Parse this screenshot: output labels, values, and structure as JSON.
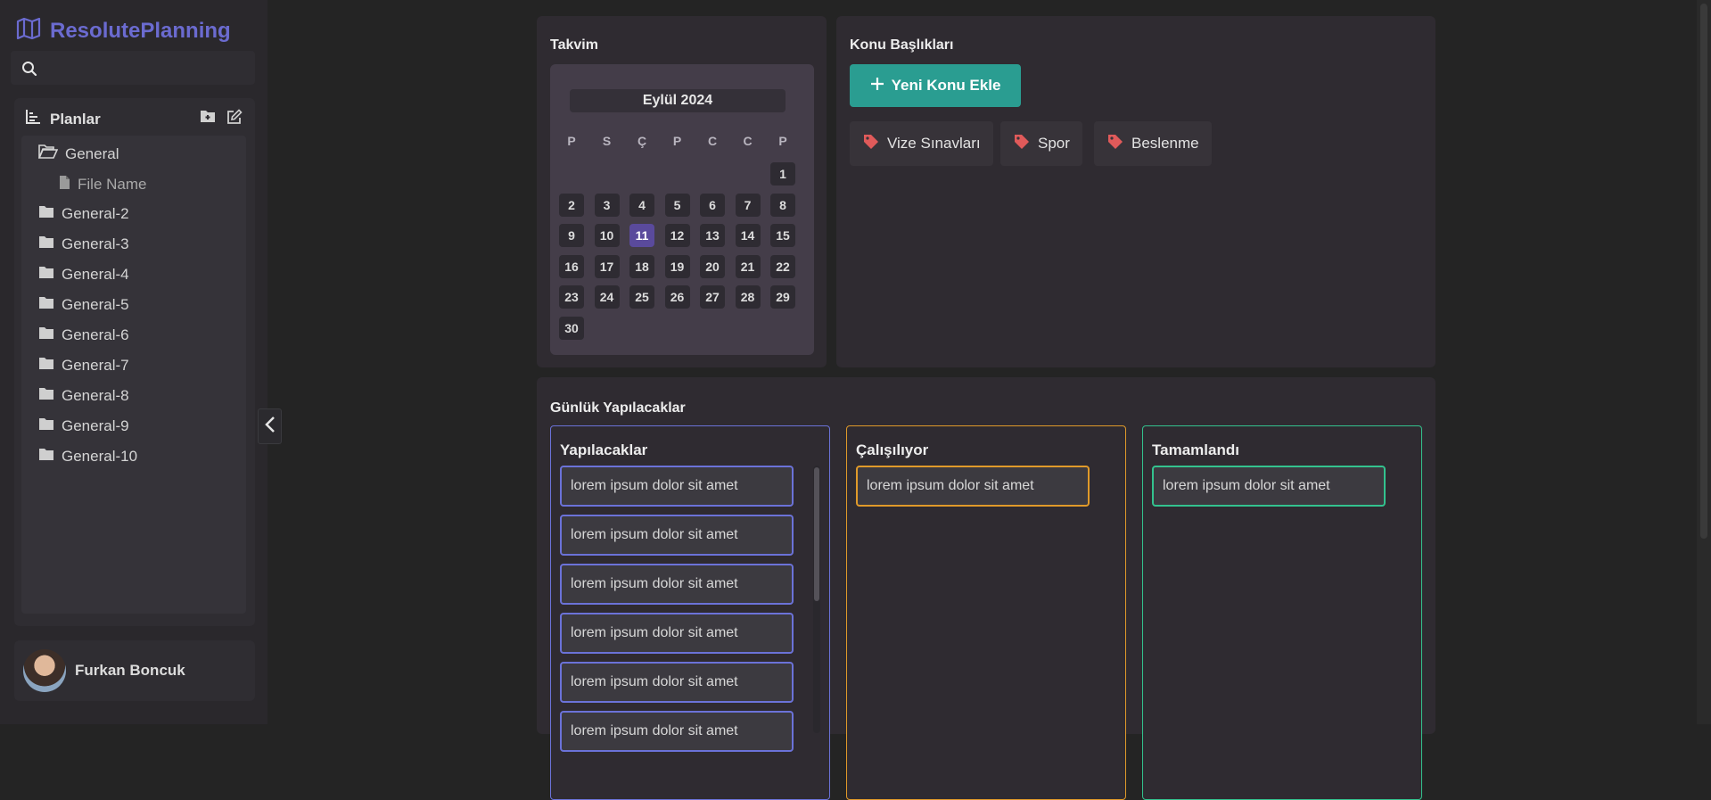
{
  "app": {
    "brand": "ResolutePlanning"
  },
  "search": {
    "placeholder": ""
  },
  "plans": {
    "title": "Planlar",
    "tree": [
      {
        "label": "General",
        "type": "folder-open"
      },
      {
        "label": "File Name",
        "type": "file"
      },
      {
        "label": "General-2",
        "type": "folder"
      },
      {
        "label": "General-3",
        "type": "folder"
      },
      {
        "label": "General-4",
        "type": "folder"
      },
      {
        "label": "General-5",
        "type": "folder"
      },
      {
        "label": "General-6",
        "type": "folder"
      },
      {
        "label": "General-7",
        "type": "folder"
      },
      {
        "label": "General-8",
        "type": "folder"
      },
      {
        "label": "General-9",
        "type": "folder"
      },
      {
        "label": "General-10",
        "type": "folder"
      }
    ]
  },
  "user": {
    "name": "Furkan Boncuk"
  },
  "calendar": {
    "title": "Takvim",
    "month": "Eylül 2024",
    "weekdays": [
      "P",
      "S",
      "Ç",
      "P",
      "C",
      "C",
      "P"
    ],
    "first_day_index": 6,
    "days_in_month": 30,
    "selected_day": 11
  },
  "topics": {
    "title": "Konu Başlıkları",
    "add_button": "Yeni Konu Ekle",
    "tags": [
      "Vize Sınavları",
      "Spor",
      "Beslenme"
    ],
    "tag_color": "#e05a5a"
  },
  "board": {
    "title": "Günlük Yapılacaklar",
    "columns": [
      {
        "title": "Yapılacaklar",
        "color": "#6b72d8",
        "tasks": [
          "lorem ipsum dolor sit amet",
          "lorem ipsum dolor sit amet",
          "lorem ipsum dolor sit amet",
          "lorem ipsum dolor sit amet",
          "lorem ipsum dolor sit amet",
          "lorem ipsum dolor sit amet"
        ]
      },
      {
        "title": "Çalışılıyor",
        "color": "#e09a2a",
        "tasks": [
          "lorem ipsum dolor sit amet"
        ]
      },
      {
        "title": "Tamamlandı",
        "color": "#33c28e",
        "tasks": [
          "lorem ipsum dolor sit amet"
        ]
      }
    ]
  },
  "colors": {
    "accent": "#6b6bd0",
    "button": "#2a9d91",
    "today": "#5a4a9c"
  }
}
